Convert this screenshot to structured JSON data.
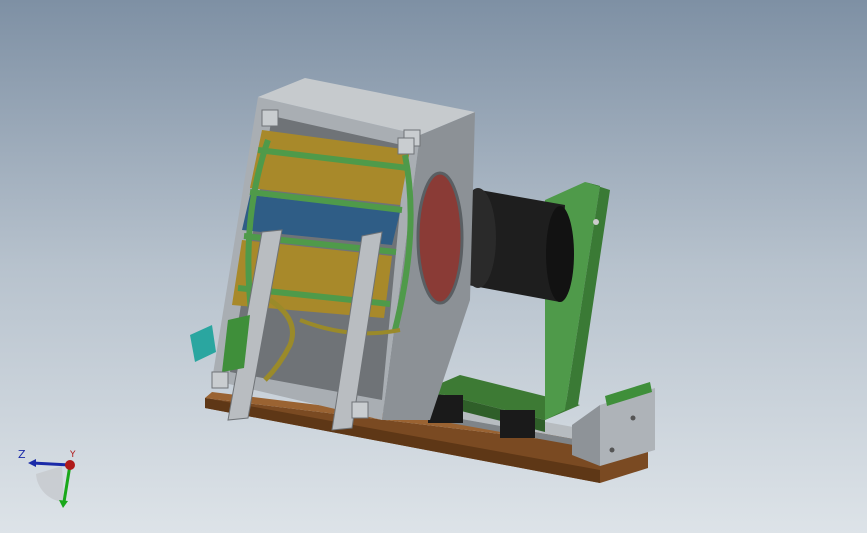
{
  "viewport": {
    "background_top": "#7e90a4",
    "background_bottom": "#dde3e8"
  },
  "model": {
    "colors": {
      "sheet_metal": "#a9aeb3",
      "sheet_metal_dark": "#8c9196",
      "pcb_green": "#4f9a4a",
      "coil_gold": "#a8892a",
      "coil_blue": "#2f5d86",
      "motor_black": "#1e1e1e",
      "window_red": "#8a3b36",
      "base_wood": "#7a4a22",
      "connector_teal": "#2aa6a0"
    }
  },
  "triad": {
    "z_label": "Z",
    "y_label": "Y",
    "z_color": "#1a2aa8",
    "y_color": "#19a81a",
    "x_color": "#b01a1a"
  }
}
